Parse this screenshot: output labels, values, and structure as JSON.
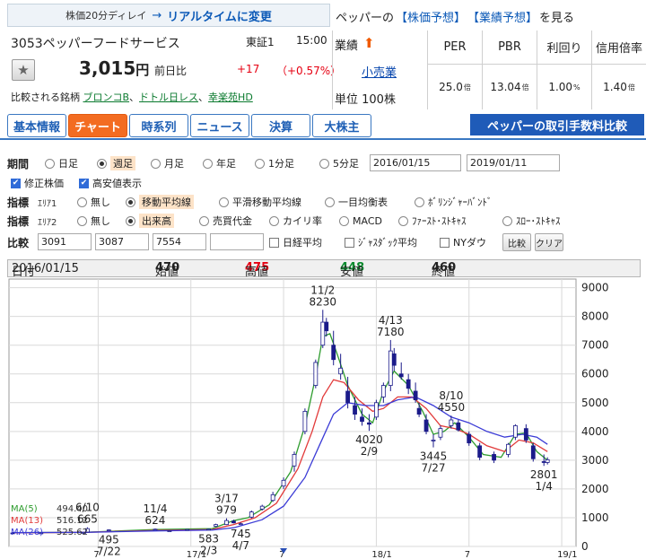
{
  "header": {
    "delay_text": "株価20分ディレイ",
    "arrow": "→",
    "realtime_link": "リアルタイムに変更",
    "forecast_prefix": "ペッパーの",
    "stock_forecast_link": "【株価予想】",
    "earnings_forecast_link": "【業績予想】",
    "forecast_suffix": "を見る"
  },
  "stock": {
    "code_name": "3053ペッパーフードサービス",
    "market": "東証1",
    "time": "15:00",
    "price": "3,015",
    "price_unit": "円",
    "prev_label": "前日比",
    "change": "+17",
    "change_pct": "（+0.57%）",
    "compare_label": "比較される銘柄",
    "compare_links": [
      "ブロンコB",
      "ドトル日レス",
      "幸楽苑HD"
    ],
    "compare_separator": "、"
  },
  "sector": {
    "label": "業績",
    "arrow_icon": "up-arrow-icon",
    "link": "小売業",
    "unit": "単位 100株"
  },
  "metrics": [
    {
      "label": "PER",
      "value": "25.0",
      "unit": "倍"
    },
    {
      "label": "PBR",
      "value": "13.04",
      "unit": "倍"
    },
    {
      "label": "利回り",
      "value": "1.00",
      "unit": "%"
    },
    {
      "label": "信用倍率",
      "value": "1.40",
      "unit": "倍"
    }
  ],
  "tabs": [
    {
      "label": "基本情報",
      "active": false
    },
    {
      "label": "チャート",
      "active": true
    },
    {
      "label": "時系列",
      "active": false
    },
    {
      "label": "ニュース",
      "active": false
    },
    {
      "label": "決算",
      "active": false
    },
    {
      "label": "大株主",
      "active": false
    }
  ],
  "fee_link": "ペッパーの取引手数料比較",
  "form": {
    "period": {
      "label": "期間",
      "options": [
        "日足",
        "週足",
        "月足",
        "年足",
        "1分足",
        "5分足"
      ],
      "selected": "週足",
      "from": "2016/01/15",
      "to": "2019/01/11"
    },
    "checks": [
      {
        "label": "修正株価",
        "checked": true
      },
      {
        "label": "高安値表示",
        "checked": true
      }
    ],
    "indicator1": {
      "label": "指標",
      "area": "ｴﾘｱ1",
      "options": [
        "無し",
        "移動平均線",
        "平滑移動平均線",
        "一目均衡表",
        "ﾎﾞﾘﾝｼﾞｬｰﾊﾞﾝﾄﾞ"
      ],
      "selected": "移動平均線"
    },
    "indicator2": {
      "label": "指標",
      "area": "ｴﾘｱ2",
      "options": [
        "無し",
        "出来高",
        "売買代金",
        "カイリ率",
        "MACD",
        "ﾌｧｰｽﾄ･ｽﾄｷｬｽ",
        "ｽﾛｰ･ｽﾄｷｬｽ"
      ],
      "selected": "出来高"
    },
    "compare": {
      "label": "比較",
      "inputs": [
        "3091",
        "3087",
        "7554",
        ""
      ],
      "checks": [
        {
          "label": "日経平均",
          "checked": false
        },
        {
          "label": "ｼﾞｬｽﾀﾞｯｸ平均",
          "checked": false
        },
        {
          "label": "NYダウ",
          "checked": false
        }
      ],
      "compare_button": "比較",
      "clear_button": "クリア"
    }
  },
  "ohlc": {
    "date_label": "日付",
    "date": "2016/01/15",
    "open_label": "始値",
    "open": "470",
    "high_label": "高値",
    "high": "475",
    "low_label": "安値",
    "low": "448",
    "close_label": "終値",
    "close": "460",
    "colors": {
      "high": "#e60012",
      "low": "#0a8a2e"
    }
  },
  "chart_data": {
    "type": "line",
    "yticks": [
      0,
      1000,
      2000,
      3000,
      4000,
      5000,
      6000,
      7000,
      8000,
      9000
    ],
    "ylim": [
      0,
      9300
    ],
    "xticks": [
      "7",
      "17/1",
      "7",
      "18/1",
      "7",
      "19/1"
    ],
    "xtick_weeks": [
      24,
      50,
      76,
      102,
      128,
      154
    ],
    "weeks": 157,
    "candles": [
      [
        0,
        470,
        475,
        448,
        460
      ],
      [
        8,
        465,
        478,
        455,
        470
      ],
      [
        20,
        480,
        495,
        470,
        485
      ],
      [
        21,
        500,
        665,
        495,
        620
      ],
      [
        27,
        560,
        595,
        540,
        575
      ],
      [
        40,
        585,
        624,
        575,
        600
      ],
      [
        44,
        540,
        565,
        520,
        545
      ],
      [
        49,
        560,
        600,
        545,
        590
      ],
      [
        55,
        583,
        615,
        575,
        600
      ],
      [
        57,
        700,
        790,
        680,
        760
      ],
      [
        60,
        760,
        979,
        745,
        900
      ],
      [
        62,
        880,
        930,
        800,
        820
      ],
      [
        64,
        760,
        830,
        745,
        790
      ],
      [
        67,
        1020,
        1250,
        980,
        1200
      ],
      [
        70,
        1300,
        1450,
        1250,
        1400
      ],
      [
        73,
        1600,
        1900,
        1550,
        1800
      ],
      [
        76,
        2100,
        2400,
        2000,
        2300
      ],
      [
        79,
        2800,
        3300,
        2600,
        3200
      ],
      [
        82,
        4000,
        4800,
        3900,
        4700
      ],
      [
        85,
        5600,
        6500,
        5500,
        6400
      ],
      [
        87,
        7000,
        8230,
        6900,
        7800
      ],
      [
        88,
        7800,
        7950,
        7300,
        7500
      ],
      [
        90,
        7000,
        7500,
        6300,
        6500
      ],
      [
        92,
        6000,
        6700,
        5800,
        6200
      ],
      [
        94,
        5400,
        5900,
        4800,
        5000
      ],
      [
        96,
        4900,
        5200,
        4400,
        4600
      ],
      [
        98,
        4500,
        4800,
        4200,
        4350
      ],
      [
        100,
        4300,
        4600,
        4020,
        4250
      ],
      [
        102,
        4500,
        5100,
        4400,
        5000
      ],
      [
        104,
        5200,
        5700,
        5000,
        5600
      ],
      [
        106,
        5600,
        7180,
        5400,
        6800
      ],
      [
        107,
        6700,
        6900,
        6100,
        6300
      ],
      [
        109,
        6000,
        6400,
        5800,
        5900
      ],
      [
        111,
        5800,
        6000,
        5300,
        5500
      ],
      [
        113,
        5400,
        5700,
        5000,
        5100
      ],
      [
        114,
        4800,
        5000,
        4500,
        4600
      ],
      [
        116,
        4400,
        4600,
        3900,
        4000
      ],
      [
        118,
        3700,
        3900,
        3445,
        3700
      ],
      [
        120,
        3800,
        4200,
        3700,
        4100
      ],
      [
        123,
        4200,
        4550,
        4100,
        4400
      ],
      [
        125,
        4300,
        4400,
        4000,
        4050
      ],
      [
        128,
        3900,
        4000,
        3500,
        3600
      ],
      [
        131,
        3500,
        3600,
        3000,
        3100
      ],
      [
        135,
        3200,
        3300,
        2900,
        3000
      ],
      [
        139,
        3200,
        3600,
        3100,
        3550
      ],
      [
        141,
        3800,
        4250,
        3700,
        4200
      ],
      [
        144,
        4100,
        4250,
        3600,
        3700
      ],
      [
        146,
        3500,
        3600,
        2950,
        3050
      ],
      [
        149,
        2950,
        3200,
        2801,
        2920
      ],
      [
        150,
        2920,
        3100,
        2850,
        3015
      ]
    ],
    "series": [
      {
        "name": "MA(5)",
        "label_value": "494.40",
        "color": "#2e9c2e",
        "points": [
          [
            0,
            480
          ],
          [
            20,
            490
          ],
          [
            40,
            590
          ],
          [
            56,
            620
          ],
          [
            62,
            900
          ],
          [
            66,
            1000
          ],
          [
            72,
            1450
          ],
          [
            78,
            2600
          ],
          [
            82,
            4200
          ],
          [
            85,
            5900
          ],
          [
            87,
            7300
          ],
          [
            89,
            7400
          ],
          [
            91,
            6700
          ],
          [
            94,
            5600
          ],
          [
            98,
            4600
          ],
          [
            101,
            4300
          ],
          [
            104,
            5400
          ],
          [
            107,
            6100
          ],
          [
            111,
            5600
          ],
          [
            115,
            4700
          ],
          [
            118,
            3900
          ],
          [
            121,
            4000
          ],
          [
            124,
            4300
          ],
          [
            128,
            3800
          ],
          [
            132,
            3200
          ],
          [
            137,
            3100
          ],
          [
            141,
            3900
          ],
          [
            144,
            3950
          ],
          [
            147,
            3300
          ],
          [
            150,
            3000
          ]
        ]
      },
      {
        "name": "MA(13)",
        "label_value": "516.12",
        "color": "#e23a3a",
        "points": [
          [
            0,
            470
          ],
          [
            20,
            490
          ],
          [
            40,
            560
          ],
          [
            56,
            590
          ],
          [
            62,
            760
          ],
          [
            68,
            1000
          ],
          [
            74,
            1500
          ],
          [
            80,
            2700
          ],
          [
            84,
            4000
          ],
          [
            87,
            5200
          ],
          [
            90,
            5800
          ],
          [
            93,
            5700
          ],
          [
            97,
            5100
          ],
          [
            101,
            4700
          ],
          [
            104,
            4800
          ],
          [
            108,
            5200
          ],
          [
            112,
            5200
          ],
          [
            116,
            4800
          ],
          [
            120,
            4200
          ],
          [
            124,
            4100
          ],
          [
            128,
            3900
          ],
          [
            133,
            3500
          ],
          [
            138,
            3300
          ],
          [
            142,
            3700
          ],
          [
            146,
            3600
          ],
          [
            150,
            3300
          ]
        ]
      },
      {
        "name": "MA(26)",
        "label_value": "525.62",
        "color": "#3b3bd6",
        "points": [
          [
            0,
            480
          ],
          [
            20,
            490
          ],
          [
            40,
            540
          ],
          [
            56,
            570
          ],
          [
            62,
            650
          ],
          [
            70,
            930
          ],
          [
            76,
            1400
          ],
          [
            82,
            2400
          ],
          [
            86,
            3500
          ],
          [
            90,
            4600
          ],
          [
            94,
            5000
          ],
          [
            99,
            4900
          ],
          [
            104,
            4900
          ],
          [
            108,
            5100
          ],
          [
            113,
            5200
          ],
          [
            118,
            4900
          ],
          [
            123,
            4500
          ],
          [
            128,
            4300
          ],
          [
            133,
            4000
          ],
          [
            138,
            3800
          ],
          [
            143,
            3900
          ],
          [
            147,
            3800
          ],
          [
            150,
            3550
          ]
        ]
      }
    ],
    "annotations": [
      {
        "text": "6/10",
        "week": 21,
        "y": 6830,
        "pos": "above"
      },
      {
        "text": "665",
        "week": 21,
        "y": 6830,
        "pos": "above2"
      },
      {
        "text": "11/4",
        "week": 40,
        "y": 6830,
        "pos": "above"
      },
      {
        "text": "624",
        "week": 40,
        "y": 6830,
        "pos": "above2"
      },
      {
        "text": "495",
        "week": 27,
        "y": 6830,
        "pos": "below"
      },
      {
        "text": "7/22",
        "week": 27,
        "y": 6830,
        "pos": "below2"
      },
      {
        "text": "583",
        "week": 55,
        "y": 6830,
        "pos": "below"
      },
      {
        "text": "2/3",
        "week": 55,
        "y": 6830,
        "pos": "below2"
      },
      {
        "text": "3/17",
        "week": 60,
        "y": 6830,
        "pos": "above"
      },
      {
        "text": "979",
        "week": 60,
        "y": 6830,
        "pos": "above2"
      },
      {
        "text": "745",
        "week": 64,
        "y": 6830,
        "pos": "below"
      },
      {
        "text": "4/7",
        "week": 64,
        "y": 6830,
        "pos": "below2"
      },
      {
        "text": "11/2",
        "week": 87,
        "y": 6830,
        "pos": "above"
      },
      {
        "text": "8230",
        "week": 87,
        "y": 6830,
        "pos": "above2"
      },
      {
        "text": "4/13",
        "week": 106,
        "y": 6830,
        "pos": "above"
      },
      {
        "text": "7180",
        "week": 106,
        "y": 6830,
        "pos": "above2"
      },
      {
        "text": "4020",
        "week": 100,
        "y": 6830,
        "pos": "below"
      },
      {
        "text": "2/9",
        "week": 100,
        "y": 6830,
        "pos": "below2"
      },
      {
        "text": "8/10",
        "week": 123,
        "y": 6830,
        "pos": "above"
      },
      {
        "text": "4550",
        "week": 123,
        "y": 6830,
        "pos": "above2"
      },
      {
        "text": "3445",
        "week": 118,
        "y": 6830,
        "pos": "below"
      },
      {
        "text": "7/27",
        "week": 118,
        "y": 6830,
        "pos": "below2"
      },
      {
        "text": "2801",
        "week": 149,
        "y": 6830,
        "pos": "below"
      },
      {
        "text": "1/4",
        "week": 149,
        "y": 6830,
        "pos": "below2"
      }
    ],
    "marker": {
      "icon": "triangle-down-icon",
      "week": 76
    }
  }
}
